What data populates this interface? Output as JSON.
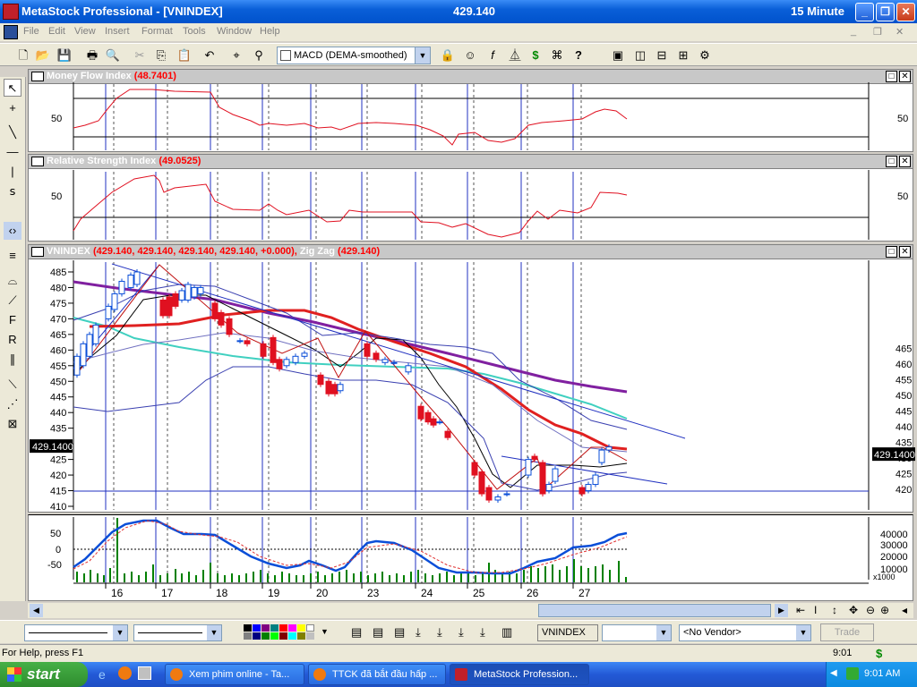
{
  "window": {
    "title_left": "MetaStock Professional - [VNINDEX]",
    "title_center": "429.140",
    "title_right": "15 Minute",
    "min": "_",
    "restore": "❐",
    "close": "✕"
  },
  "menu": [
    "File",
    "Edit",
    "View",
    "Insert",
    "Format",
    "Tools",
    "Window",
    "Help"
  ],
  "toolbar": {
    "indicator_value": "MACD (DEMA-smoothed)",
    "icons": [
      "new-icon",
      "open-icon",
      "save-icon",
      "print-icon",
      "print-preview-icon",
      "cut-icon",
      "copy-icon",
      "paste-icon",
      "undo-icon",
      "crosshair-icon",
      "zoom-icon",
      "explorer-icon",
      "expert-icon",
      "formula-icon",
      "system-tester-icon",
      "dollar-icon",
      "binoculars-icon",
      "help-icon",
      "tile-icon",
      "tile-v-icon",
      "tile-h-icon",
      "grid-icon",
      "properties-icon"
    ]
  },
  "panes": {
    "mfi": {
      "label": "Money Flow Index",
      "value": "(48.7401)",
      "axis_left": "50",
      "axis_right": "50"
    },
    "rsi": {
      "label": "Relative Strength Index",
      "value": "(49.0525)",
      "axis_left": "50",
      "axis_right": "50"
    },
    "price": {
      "label": "VNINDEX",
      "value": "(429.140, 429.140, 429.140, 429.140, +0.000),",
      "zz_label": "Zig Zag",
      "zz_value": "(429.140)",
      "left_ticks": [
        "485",
        "480",
        "475",
        "470",
        "465",
        "460",
        "455",
        "450",
        "445",
        "440",
        "435",
        "430",
        "425",
        "420",
        "415",
        "410"
      ],
      "right_ticks": [
        "465",
        "460",
        "455",
        "450",
        "445",
        "440",
        "435",
        "430",
        "425",
        "420"
      ],
      "last_tag": "429.1400"
    },
    "macd": {
      "left_ticks": [
        "50",
        "0",
        "-50"
      ],
      "right_ticks": [
        "40000",
        "30000",
        "20000",
        "10000"
      ],
      "multiplier": "x1000"
    }
  },
  "dates": [
    "16",
    "17",
    "18",
    "19",
    "20",
    "23",
    "24",
    "25",
    "26",
    "27"
  ],
  "chart_data": [
    {
      "type": "line",
      "title": "Money Flow Index",
      "value": 48.7401,
      "ylim": [
        0,
        100
      ]
    },
    {
      "type": "line",
      "title": "Relative Strength Index",
      "value": 49.0525,
      "ylim": [
        0,
        100
      ]
    },
    {
      "type": "candlestick",
      "title": "VNINDEX",
      "last": 429.14,
      "ylim": [
        410,
        487
      ],
      "x": [
        "16",
        "17",
        "18",
        "19",
        "20",
        "23",
        "24",
        "25",
        "26",
        "27"
      ],
      "close": [
        458,
        474,
        470,
        463,
        452,
        459,
        438,
        414,
        420,
        429.14
      ]
    },
    {
      "type": "line",
      "title": "MACD (DEMA-smoothed)",
      "ylim": [
        -70,
        70
      ]
    }
  ],
  "bottom": {
    "symbol": "VNINDEX",
    "vendor": "<No Vendor>",
    "trade": "Trade"
  },
  "status": {
    "help": "For Help, press F1",
    "time": "9:01"
  },
  "taskbar": {
    "start": "start",
    "tasks": [
      "Xem phim online - Ta...",
      "TTCK đã bắt đầu hấp ...",
      "MetaStock Profession..."
    ],
    "clock": "9:01 AM"
  },
  "colors": {
    "bar_blue": "#0a4ed8",
    "price_red": "#e01020",
    "vline": "#2030c0",
    "purple": "#8020a0",
    "teal": "#40d0c0"
  }
}
